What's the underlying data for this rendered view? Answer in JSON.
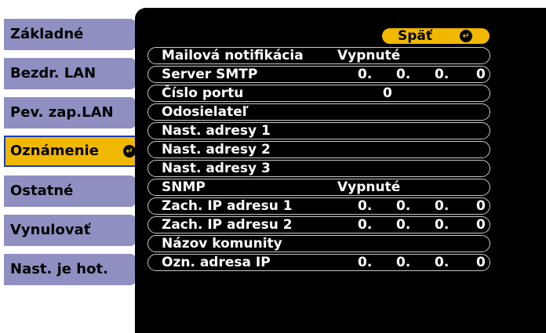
{
  "sidebar": {
    "items": [
      {
        "label": "Základné"
      },
      {
        "label": "Bezdr. LAN"
      },
      {
        "label": "Pev. zap.LAN"
      },
      {
        "label": "Oznámenie",
        "active": true
      },
      {
        "label": "Ostatné"
      },
      {
        "label": "Vynulovať"
      },
      {
        "label": "Nast. je hot."
      }
    ]
  },
  "back": {
    "label": "Späť",
    "icon": "enter-icon"
  },
  "rows": {
    "mail": {
      "label": "Mailová notifikácia",
      "value": "Vypnuté"
    },
    "smtp": {
      "label": "Server SMTP",
      "ip": [
        "0.",
        "0.",
        "0.",
        "0"
      ]
    },
    "port": {
      "label": "Číslo portu",
      "value": "0"
    },
    "sender": {
      "label": "Odosielateľ"
    },
    "addr1": {
      "label": "Nast. adresy 1"
    },
    "addr2": {
      "label": "Nast. adresy 2"
    },
    "addr3": {
      "label": "Nast. adresy 3"
    },
    "snmp": {
      "label": "SNMP",
      "value": "Vypnuté"
    },
    "trap1": {
      "label": "Zach. IP adresu 1",
      "ip": [
        "0.",
        "0.",
        "0.",
        "0"
      ]
    },
    "trap2": {
      "label": "Zach. IP adresu 2",
      "ip": [
        "0.",
        "0.",
        "0.",
        "0"
      ]
    },
    "community": {
      "label": "Názov komunity"
    },
    "ipaddr": {
      "label": "Ozn. adresa IP",
      "ip": [
        "0.",
        "0.",
        "0.",
        "0"
      ]
    }
  },
  "colors": {
    "tab": "#8f8fc1",
    "active": "#f0b800",
    "active_border": "#1a3db5",
    "panel": "#000000"
  }
}
